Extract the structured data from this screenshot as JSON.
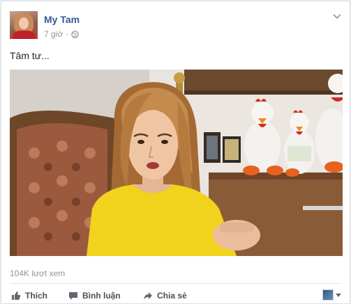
{
  "post": {
    "author": "My Tam",
    "time": "7 giờ",
    "text": "Tâm tư...",
    "views": "104K lượt xem"
  },
  "icons": {
    "privacy": "globe-icon",
    "options": "chevron-down-icon",
    "like": "thumbs-up-icon",
    "comment": "comment-bubble-icon",
    "share": "share-arrow-icon"
  },
  "actions": {
    "like_label": "Thích",
    "comment_label": "Bình luận",
    "share_label": "Chia sẻ"
  },
  "colors": {
    "author_link": "#365899",
    "meta_text": "#90949c",
    "action_text": "#4b4f56"
  }
}
